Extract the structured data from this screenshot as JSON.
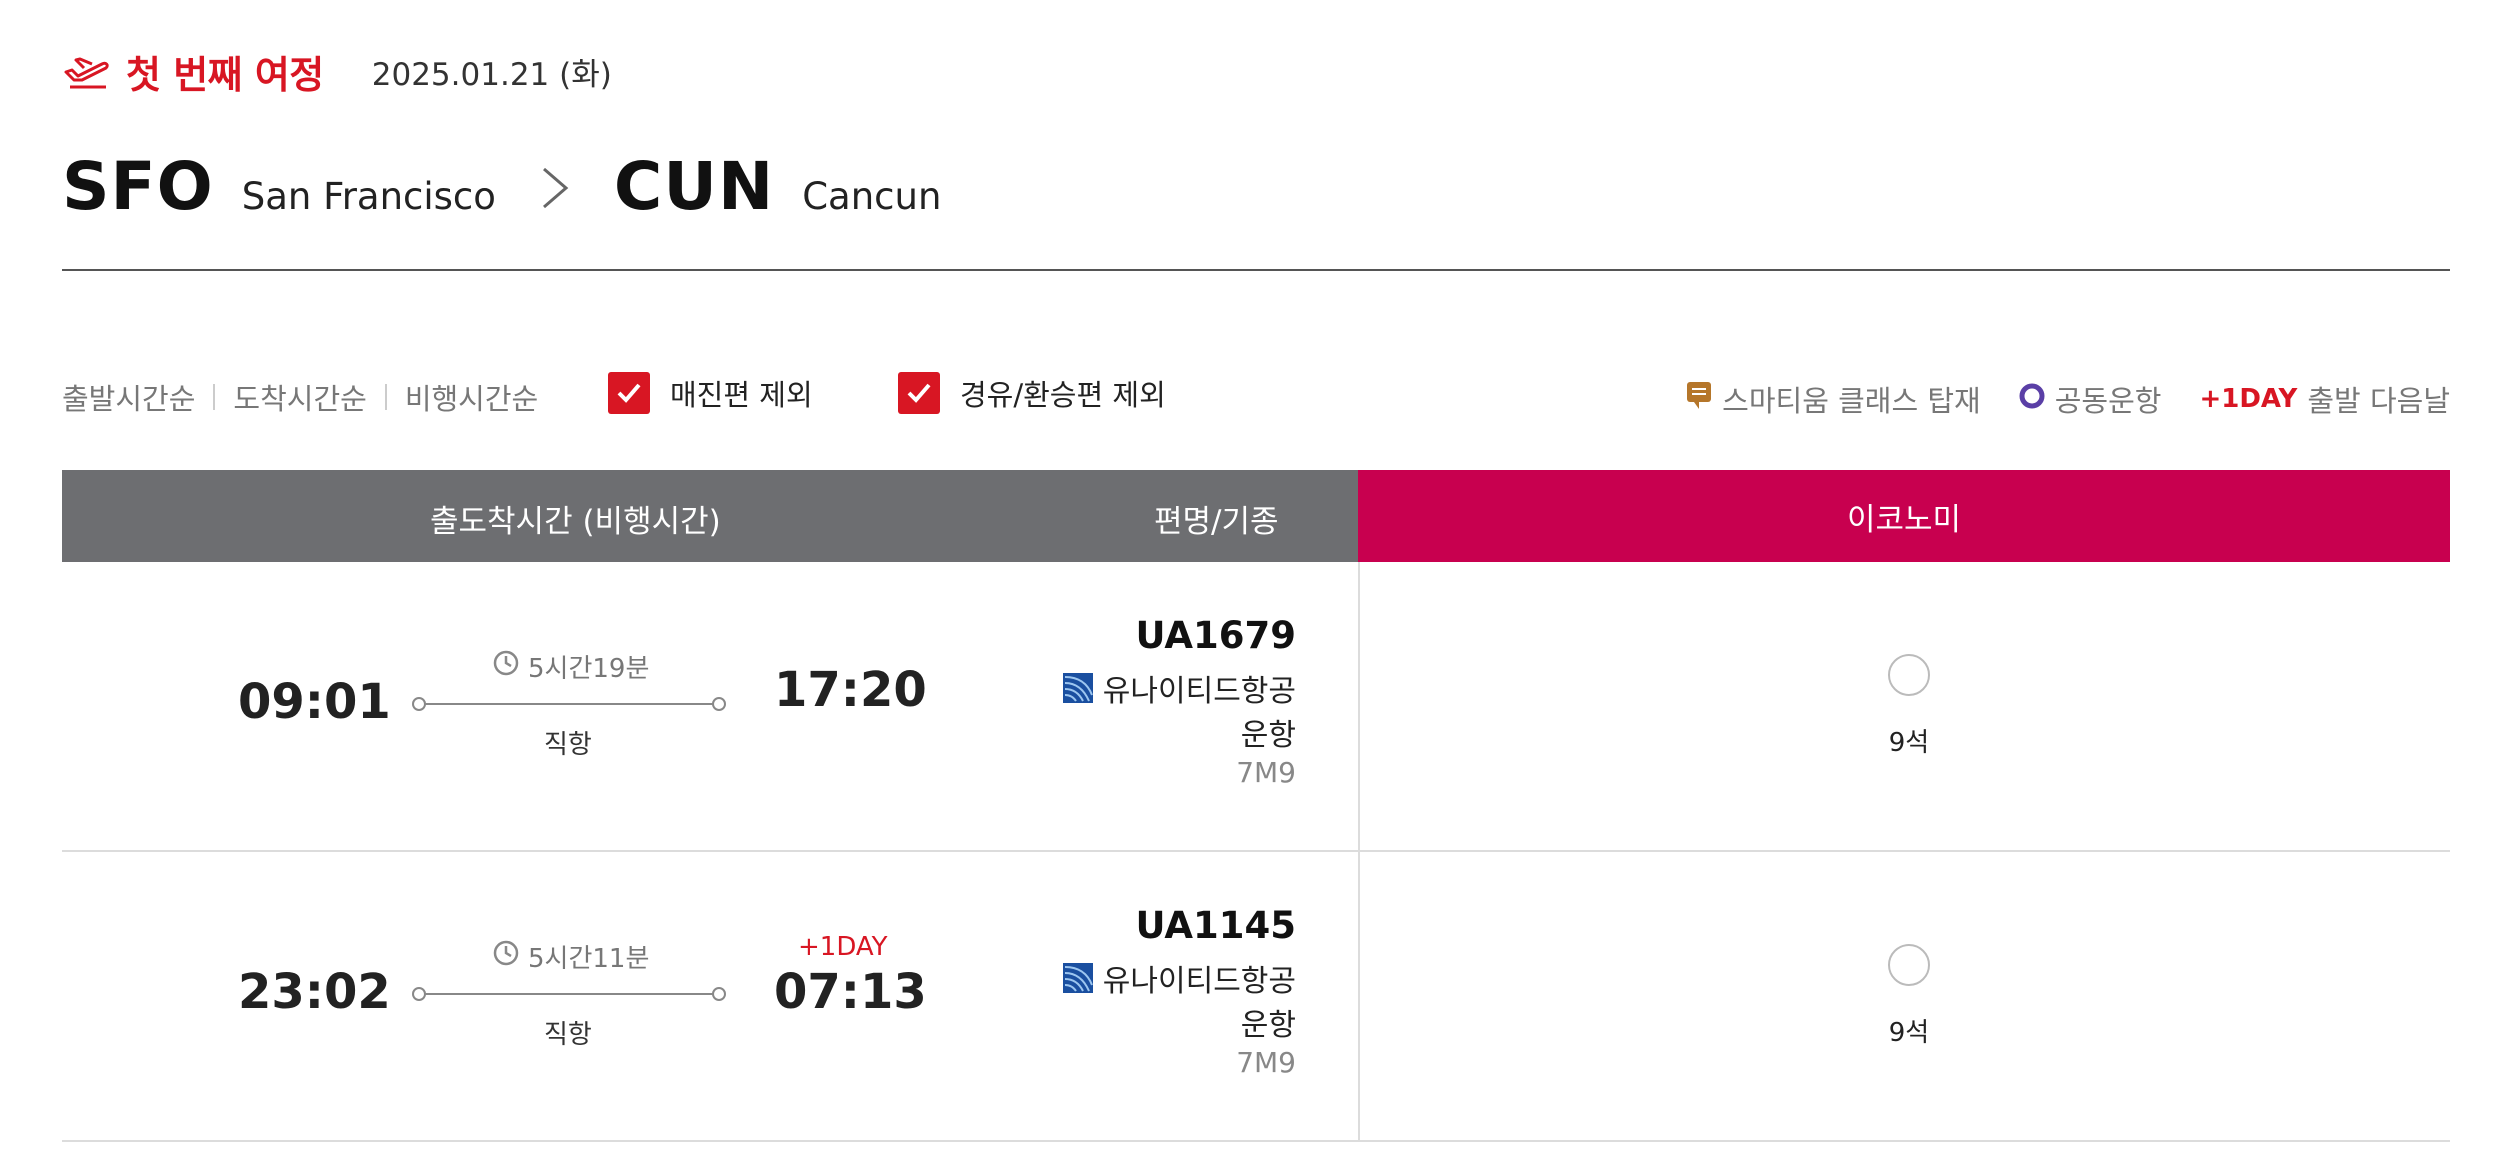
{
  "journey": {
    "title": "첫 번째 여정",
    "date": "2025.01.21 (화)"
  },
  "route": {
    "origin_code": "SFO",
    "origin_city": "San Francisco",
    "dest_code": "CUN",
    "dest_city": "Cancun"
  },
  "sort": {
    "departure": "출발시간순",
    "arrival": "도착시간순",
    "duration": "비행시간순"
  },
  "filters": {
    "exclude_soldout": "매진편 제외",
    "exclude_transfer": "경유/환승편 제외"
  },
  "legend": {
    "smartium": "스마티움 클래스 탑재",
    "codeshare": "공동운항",
    "next_day_tag": "+1DAY",
    "next_day": "출발 다음날"
  },
  "table_header": {
    "time": "출도착시간 (비행시간)",
    "flight": "편명/기종",
    "economy": "이코노미"
  },
  "flights": [
    {
      "departure": "09:01",
      "arrival": "17:20",
      "next_day": "",
      "duration": "5시간19분",
      "type": "직항",
      "flight_no": "UA1679",
      "airline": "유나이티드항공",
      "operated": "운항",
      "aircraft": "7M9",
      "seats": "9석"
    },
    {
      "departure": "23:02",
      "arrival": "07:13",
      "next_day": "+1DAY",
      "duration": "5시간11분",
      "type": "직항",
      "flight_no": "UA1145",
      "airline": "유나이티드항공",
      "operated": "운항",
      "aircraft": "7M9",
      "seats": "9석"
    }
  ],
  "colors": {
    "accent_red": "#d81623",
    "economy_header": "#c8004f",
    "table_header": "#6d6e71"
  }
}
